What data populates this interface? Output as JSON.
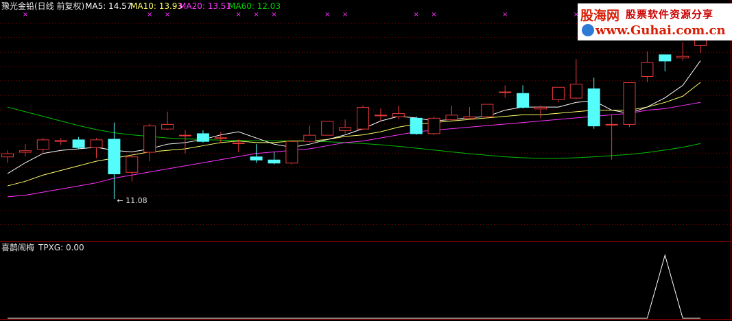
{
  "header": {
    "title": "豫光金铅(日线 前复权)",
    "ma5_label": "MA5: 14.57",
    "ma10_label": "MA10: 13.93",
    "ma20_label": "MA20: 13.51",
    "ma60_label": "MA60: 12.03"
  },
  "indicator": {
    "name": "喜鹊闹梅",
    "value_label": "TPXG: 0.00"
  },
  "watermark": {
    "line1": "股海网",
    "line2": "股票软件资源分享",
    "line3": "www.Guhai.com.cn"
  },
  "colors": {
    "background": "#000000",
    "up_candle": "#e8393b",
    "down_candle": "#54fcfc",
    "ma5": "#ffffff",
    "ma10": "#ffff66",
    "ma20": "#ff33ff",
    "ma60": "#00c000",
    "grid": "#880000",
    "indicator_line": "#ffffff",
    "marker": "#ff33ff"
  },
  "chart_data": {
    "type": "candlestick",
    "price_range": [
      9.75,
      17.2
    ],
    "grid_prices": [
      16.75,
      16.3,
      15.82,
      15.35,
      14.9,
      14.42,
      13.95,
      13.5,
      13.02,
      12.56,
      12.1,
      11.63,
      11.18,
      10.7,
      10.25
    ],
    "low_annotation": "11.08",
    "low_annotation_candle": 6,
    "candles": [
      {
        "o": 12.45,
        "c": 12.55,
        "h": 12.65,
        "l": 12.25
      },
      {
        "o": 12.6,
        "c": 12.65,
        "h": 12.85,
        "l": 12.45
      },
      {
        "o": 12.7,
        "c": 13.0,
        "h": 13.05,
        "l": 12.55
      },
      {
        "o": 12.95,
        "c": 12.98,
        "h": 13.05,
        "l": 12.82
      },
      {
        "o": 13.0,
        "c": 12.75,
        "h": 13.08,
        "l": 12.7
      },
      {
        "o": 12.75,
        "c": 13.0,
        "h": 13.05,
        "l": 12.4
      },
      {
        "o": 13.02,
        "c": 11.9,
        "h": 13.55,
        "l": 11.08
      },
      {
        "o": 11.95,
        "c": 12.45,
        "h": 12.5,
        "l": 11.65
      },
      {
        "o": 12.6,
        "c": 13.45,
        "h": 13.5,
        "l": 12.3
      },
      {
        "o": 13.35,
        "c": 13.5,
        "h": 13.9,
        "l": 13.3
      },
      {
        "o": 13.15,
        "c": 13.15,
        "h": 13.3,
        "l": 12.55
      },
      {
        "o": 13.2,
        "c": 12.95,
        "h": 13.3,
        "l": 12.9
      },
      {
        "o": 13.05,
        "c": 13.07,
        "h": 13.25,
        "l": 12.9
      },
      {
        "o": 12.9,
        "c": 12.9,
        "h": 13.0,
        "l": 12.6
      },
      {
        "o": 12.45,
        "c": 12.35,
        "h": 12.85,
        "l": 12.25
      },
      {
        "o": 12.35,
        "c": 12.25,
        "h": 12.6,
        "l": 12.2
      },
      {
        "o": 12.25,
        "c": 12.95,
        "h": 12.95,
        "l": 12.2
      },
      {
        "o": 12.95,
        "c": 13.15,
        "h": 13.45,
        "l": 12.9
      },
      {
        "o": 13.15,
        "c": 13.6,
        "h": 13.6,
        "l": 13.15
      },
      {
        "o": 13.3,
        "c": 13.4,
        "h": 13.65,
        "l": 13.2
      },
      {
        "o": 13.35,
        "c": 14.05,
        "h": 14.1,
        "l": 13.3
      },
      {
        "o": 13.8,
        "c": 13.8,
        "h": 14.0,
        "l": 13.6
      },
      {
        "o": 13.75,
        "c": 13.85,
        "h": 14.1,
        "l": 13.65
      },
      {
        "o": 13.7,
        "c": 13.2,
        "h": 13.75,
        "l": 13.15
      },
      {
        "o": 13.2,
        "c": 13.7,
        "h": 13.75,
        "l": 13.15
      },
      {
        "o": 13.65,
        "c": 13.8,
        "h": 14.1,
        "l": 13.6
      },
      {
        "o": 13.7,
        "c": 13.75,
        "h": 14.05,
        "l": 13.65
      },
      {
        "o": 13.75,
        "c": 14.15,
        "h": 14.15,
        "l": 13.7
      },
      {
        "o": 14.55,
        "c": 14.55,
        "h": 14.75,
        "l": 14.35
      },
      {
        "o": 14.5,
        "c": 14.05,
        "h": 14.75,
        "l": 14.0
      },
      {
        "o": 14.0,
        "c": 14.05,
        "h": 14.1,
        "l": 13.7
      },
      {
        "o": 14.3,
        "c": 14.7,
        "h": 14.7,
        "l": 14.2
      },
      {
        "o": 14.35,
        "c": 14.8,
        "h": 15.6,
        "l": 14.3
      },
      {
        "o": 14.65,
        "c": 13.45,
        "h": 15.0,
        "l": 13.35
      },
      {
        "o": 13.5,
        "c": 13.5,
        "h": 13.8,
        "l": 12.35
      },
      {
        "o": 13.5,
        "c": 14.85,
        "h": 14.85,
        "l": 13.4
      },
      {
        "o": 15.05,
        "c": 15.5,
        "h": 15.85,
        "l": 14.85
      },
      {
        "o": 15.75,
        "c": 15.55,
        "h": 15.75,
        "l": 15.2
      },
      {
        "o": 15.65,
        "c": 15.7,
        "h": 16.15,
        "l": 15.55
      },
      {
        "o": 16.05,
        "c": 16.8,
        "h": 16.9,
        "l": 15.8
      }
    ],
    "ma5": [
      11.9,
      12.25,
      12.55,
      12.65,
      12.7,
      12.75,
      12.65,
      12.6,
      12.7,
      12.85,
      12.9,
      13.0,
      13.15,
      13.25,
      13.05,
      12.85,
      12.75,
      12.85,
      13.0,
      13.15,
      13.35,
      13.6,
      13.75,
      13.7,
      13.6,
      13.65,
      13.7,
      13.75,
      13.95,
      14.05,
      14.05,
      14.05,
      14.2,
      14.25,
      13.95,
      13.85,
      14.05,
      14.35,
      14.75,
      15.55
    ],
    "ma10": [
      11.5,
      11.65,
      11.85,
      12.0,
      12.15,
      12.3,
      12.4,
      12.5,
      12.6,
      12.65,
      12.7,
      12.8,
      12.9,
      12.95,
      12.9,
      12.9,
      12.95,
      12.95,
      13.0,
      13.1,
      13.15,
      13.25,
      13.4,
      13.5,
      13.55,
      13.6,
      13.65,
      13.7,
      13.75,
      13.8,
      13.8,
      13.85,
      13.9,
      13.95,
      13.95,
      13.95,
      14.05,
      14.2,
      14.4,
      14.85
    ],
    "ma20": [
      11.15,
      11.2,
      11.3,
      11.4,
      11.5,
      11.6,
      11.75,
      11.85,
      11.95,
      12.05,
      12.15,
      12.25,
      12.35,
      12.45,
      12.55,
      12.6,
      12.65,
      12.7,
      12.8,
      12.9,
      12.95,
      13.05,
      13.15,
      13.25,
      13.3,
      13.35,
      13.4,
      13.45,
      13.5,
      13.55,
      13.6,
      13.65,
      13.7,
      13.75,
      13.8,
      13.85,
      13.95,
      14.0,
      14.1,
      14.2
    ],
    "ma60": [
      14.05,
      13.9,
      13.75,
      13.6,
      13.45,
      13.32,
      13.22,
      13.15,
      13.1,
      13.05,
      13.02,
      13.0,
      12.98,
      12.97,
      12.96,
      12.96,
      12.96,
      12.95,
      12.93,
      12.9,
      12.87,
      12.83,
      12.78,
      12.72,
      12.66,
      12.6,
      12.54,
      12.49,
      12.44,
      12.41,
      12.39,
      12.39,
      12.41,
      12.44,
      12.48,
      12.52,
      12.58,
      12.66,
      12.75,
      12.87
    ],
    "markers_at_candles": [
      1,
      8,
      9,
      13,
      14,
      15,
      18,
      19,
      23,
      24,
      28,
      32
    ],
    "tpxg_values": [
      0,
      0,
      0,
      0,
      0,
      0,
      0,
      0,
      0,
      0,
      0,
      0,
      0,
      0,
      0,
      0,
      0,
      0,
      0,
      0,
      0,
      0,
      0,
      0,
      0,
      0,
      0,
      0,
      0,
      0,
      0,
      0,
      0,
      0,
      0,
      0,
      0,
      1,
      0,
      0
    ]
  }
}
